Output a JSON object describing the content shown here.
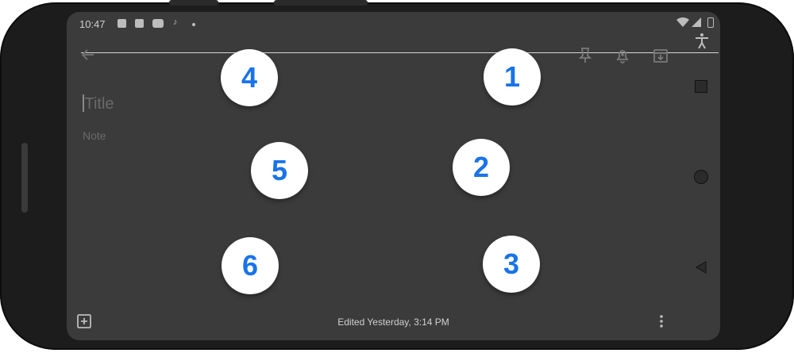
{
  "status_bar": {
    "time": "10:47",
    "icons": [
      "image-icon",
      "gallery-icon",
      "youtube-icon",
      "music-icon",
      "dot-icon"
    ],
    "right_icons": [
      "wifi-icon",
      "signal-icon",
      "battery-icon"
    ]
  },
  "toolbar": {
    "back_icon": "arrow-left-icon",
    "actions": [
      "pin-icon",
      "reminder-bell-icon",
      "archive-icon"
    ]
  },
  "note": {
    "title_placeholder": "Title",
    "body_placeholder": "Note"
  },
  "footer": {
    "add_icon": "add-box-icon",
    "edited_text": "Edited Yesterday, 3:14 PM",
    "more_icon": "more-vert-icon"
  },
  "badges": [
    {
      "label": "1"
    },
    {
      "label": "2"
    },
    {
      "label": "3"
    },
    {
      "label": "4"
    },
    {
      "label": "5"
    },
    {
      "label": "6"
    }
  ],
  "nav": {
    "items": [
      "accessibility-icon",
      "recents-icon",
      "home-icon",
      "back-icon"
    ]
  },
  "colors": {
    "badge_text": "#1a73e8",
    "screen_bg": "#3b3b3b",
    "phone_frame": "#1c1c1c"
  }
}
